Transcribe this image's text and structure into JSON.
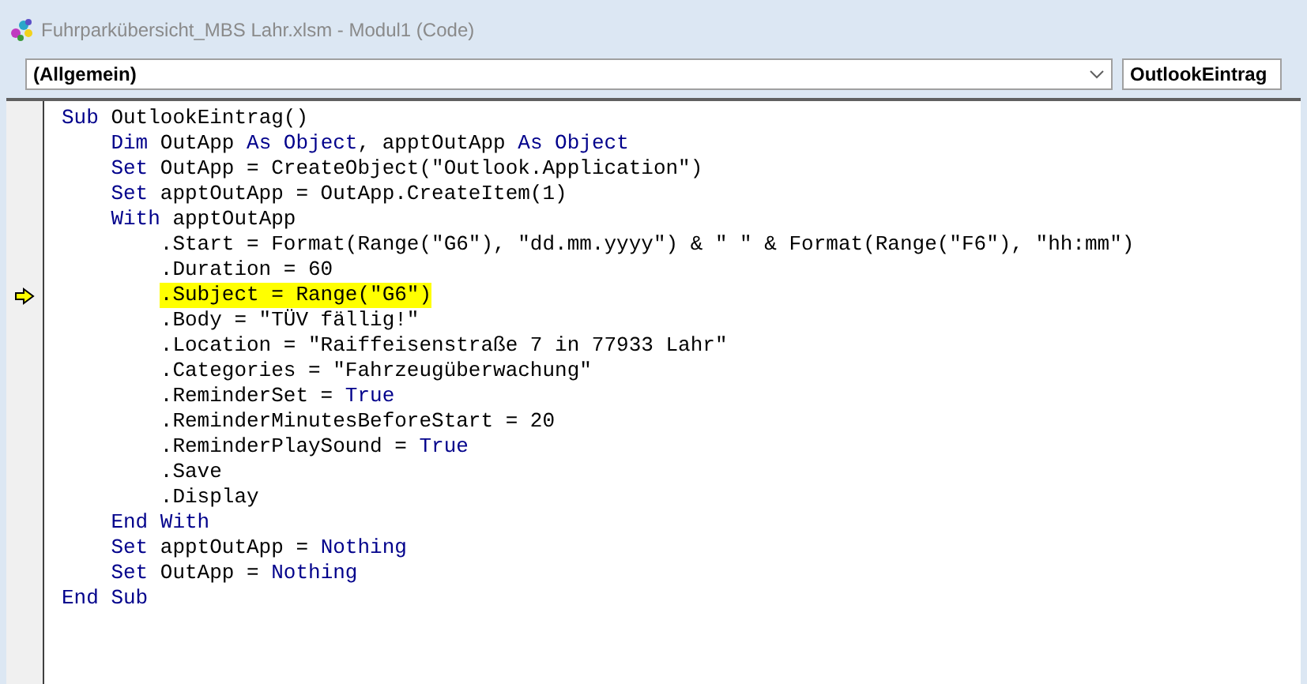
{
  "window": {
    "title": "Fuhrparkübersicht_MBS Lahr.xlsm - Modul1 (Code)"
  },
  "object_dropdown": {
    "value": "(Allgemein)"
  },
  "procedure_dropdown": {
    "value": "OutlookEintrag"
  },
  "code": [
    {
      "current": false,
      "tokens": [
        {
          "kind": "keyword",
          "text": "Sub"
        },
        {
          "kind": "plain",
          "text": " OutlookEintrag()"
        }
      ],
      "children": [
        {
          "current": false,
          "tokens": [
            {
              "kind": "keyword",
              "text": "Dim"
            },
            {
              "kind": "plain",
              "text": " OutApp "
            },
            {
              "kind": "keyword",
              "text": "As Object"
            },
            {
              "kind": "plain",
              "text": ", apptOutApp "
            },
            {
              "kind": "keyword",
              "text": "As Object"
            }
          ]
        },
        {
          "current": false,
          "tokens": [
            {
              "kind": "keyword",
              "text": "Set"
            },
            {
              "kind": "plain",
              "text": " OutApp = CreateObject(\"Outlook.Application\")"
            }
          ]
        },
        {
          "current": false,
          "tokens": [
            {
              "kind": "keyword",
              "text": "Set"
            },
            {
              "kind": "plain",
              "text": " apptOutApp = OutApp.CreateItem(1)"
            }
          ]
        },
        {
          "current": false,
          "tokens": [
            {
              "kind": "keyword",
              "text": "With"
            },
            {
              "kind": "plain",
              "text": " apptOutApp"
            }
          ],
          "children": [
            {
              "current": false,
              "tokens": [
                {
                  "kind": "plain",
                  "text": ".Start = Format(Range(\"G6\"), \"dd.mm.yyyy\") & \" \" & Format(Range(\"F6\"), \"hh:mm\")"
                }
              ]
            },
            {
              "current": false,
              "tokens": [
                {
                  "kind": "plain",
                  "text": ".Duration = 60"
                }
              ]
            },
            {
              "current": true,
              "tokens": [
                {
                  "kind": "plain",
                  "text": ".Subject = Range(\"G6\")"
                }
              ]
            },
            {
              "current": false,
              "tokens": [
                {
                  "kind": "plain",
                  "text": ".Body = \"TÜV fällig!\""
                }
              ]
            },
            {
              "current": false,
              "tokens": [
                {
                  "kind": "plain",
                  "text": ".Location = \"Raiffeisenstraße 7 in 77933 Lahr\""
                }
              ]
            },
            {
              "current": false,
              "tokens": [
                {
                  "kind": "plain",
                  "text": ".Categories = \"Fahrzeugüberwachung\""
                }
              ]
            },
            {
              "current": false,
              "tokens": [
                {
                  "kind": "plain",
                  "text": ".ReminderSet = "
                },
                {
                  "kind": "keyword",
                  "text": "True"
                }
              ]
            },
            {
              "current": false,
              "tokens": [
                {
                  "kind": "plain",
                  "text": ".ReminderMinutesBeforeStart = 20"
                }
              ]
            },
            {
              "current": false,
              "tokens": [
                {
                  "kind": "plain",
                  "text": ".ReminderPlaySound = "
                },
                {
                  "kind": "keyword",
                  "text": "True"
                }
              ]
            },
            {
              "current": false,
              "tokens": [
                {
                  "kind": "plain",
                  "text": ".Save"
                }
              ]
            },
            {
              "current": false,
              "tokens": [
                {
                  "kind": "plain",
                  "text": ".Display"
                }
              ]
            }
          ]
        },
        {
          "current": false,
          "tokens": [
            {
              "kind": "keyword",
              "text": "End With"
            }
          ]
        },
        {
          "current": false,
          "tokens": [
            {
              "kind": "keyword",
              "text": "Set"
            },
            {
              "kind": "plain",
              "text": " apptOutApp = "
            },
            {
              "kind": "keyword",
              "text": "Nothing"
            }
          ]
        },
        {
          "current": false,
          "tokens": [
            {
              "kind": "keyword",
              "text": "Set"
            },
            {
              "kind": "plain",
              "text": " OutApp = "
            },
            {
              "kind": "keyword",
              "text": "Nothing"
            }
          ]
        }
      ]
    },
    {
      "current": false,
      "tokens": [
        {
          "kind": "keyword",
          "text": "End Sub"
        }
      ]
    }
  ]
}
